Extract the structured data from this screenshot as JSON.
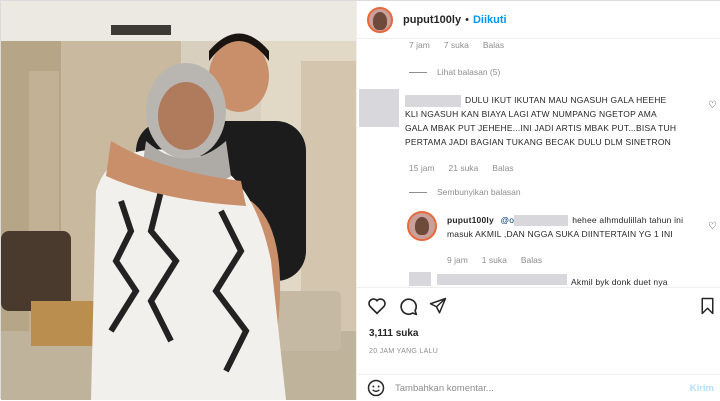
{
  "header": {
    "username": "puput100ly",
    "dot": "•",
    "follow_label": "Diikuti"
  },
  "comments": {
    "top_meta": {
      "time": "7 jam",
      "likes": "7 suka",
      "reply": "Balas"
    },
    "view_replies": "Lihat balasan (5)",
    "comment1": {
      "lines": [
        "DULU IKUT IKUTAN MAU NGASUH GALA HEEHE",
        "KLI NGASUH KAN BIAYA LAGI ATW NUMPANG NGETOP AMA",
        "GALA MBAK PUT JEHEHE...INI JADI ARTIS MBAK PUT...BISA TUH",
        "PERTAMA JADI BAGIAN TUKANG BECAK DULU DLM SINETRON"
      ],
      "time": "15 jam",
      "likes": "21 suka",
      "reply": "Balas"
    },
    "hide_replies": "Sembunyikan balasan",
    "reply1": {
      "username": "puput100ly",
      "mention": "@o",
      "text_first": "hehee alhmdulillah tahun ini",
      "text_second": "masuk AKMIL ,DAN NGGA SUKA DIINTERTAIN YG 1 INI",
      "time": "9 jam",
      "likes": "1 suka",
      "reply": "Balas"
    },
    "reply2_partial": "Akmil byk donk duet nya"
  },
  "actions": {
    "likes": "3,111 suka",
    "time": "20 JAM YANG LALU",
    "add_placeholder": "Tambahkan komentar...",
    "send_label": "Kirim"
  },
  "colors": {
    "accent": "#0095f6",
    "muted": "#8e8e8e",
    "send_disabled": "#b2dffc"
  }
}
